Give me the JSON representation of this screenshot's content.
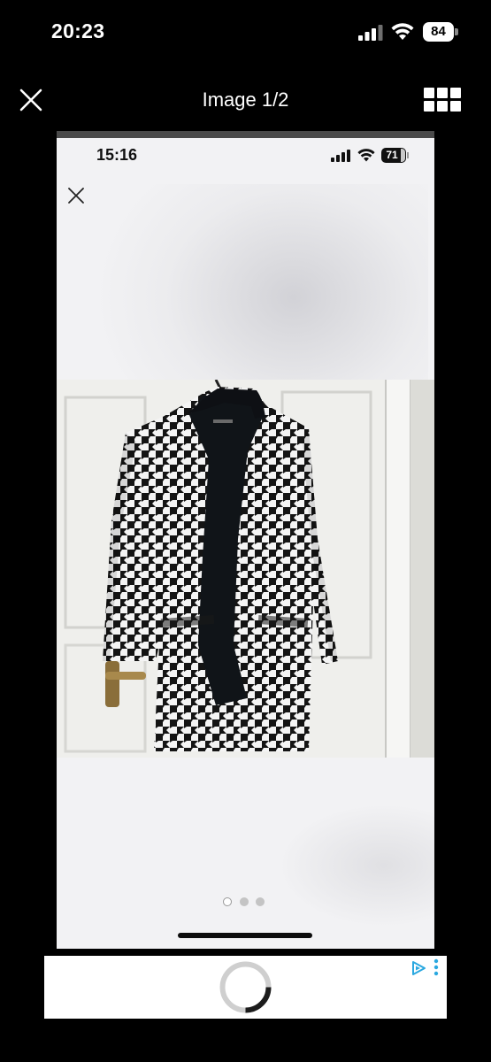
{
  "status_bar": {
    "time": "20:23",
    "battery": "84",
    "icons": [
      "signal-icon",
      "wifi-icon",
      "battery-icon"
    ]
  },
  "header": {
    "title": "Image 1/2",
    "icons": [
      "close-icon",
      "grid-icon"
    ]
  },
  "screenshot": {
    "status_bar": {
      "time": "15:16",
      "battery": "71"
    },
    "icons": [
      "close-icon"
    ],
    "photo": {
      "subject": "houndstooth-coat-on-door"
    },
    "pagination": {
      "total": 3,
      "active": 1
    }
  },
  "ad": {
    "icons": [
      "spinner-icon",
      "adchoices-icon",
      "more-vertical-icon"
    ]
  },
  "colors": {
    "background": "#000000",
    "screenshot_bg": "#f2f2f4",
    "ad_bg": "#ffffff",
    "adchoices": "#2aa8e0"
  }
}
